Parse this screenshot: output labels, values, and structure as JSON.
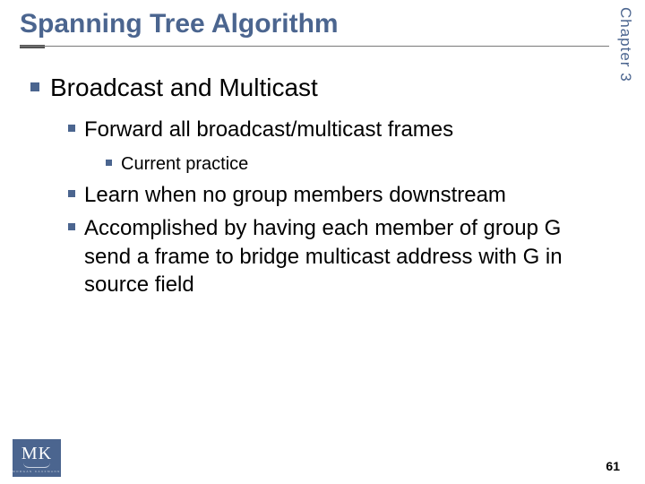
{
  "chapter_label": "Chapter 3",
  "title": "Spanning Tree Algorithm",
  "content": {
    "lvl1": "Broadcast and Multicast",
    "lvl2": [
      {
        "text": "Forward all broadcast/multicast frames",
        "lvl3": [
          {
            "text": "Current practice"
          }
        ]
      },
      {
        "text": "Learn when no group members downstream"
      },
      {
        "text": "Accomplished by having each member of group G send a frame to bridge multicast address with G in source field"
      }
    ]
  },
  "page_number": "61",
  "logo": {
    "initials": "MK",
    "publisher": "MORGAN KAUFMANN"
  }
}
